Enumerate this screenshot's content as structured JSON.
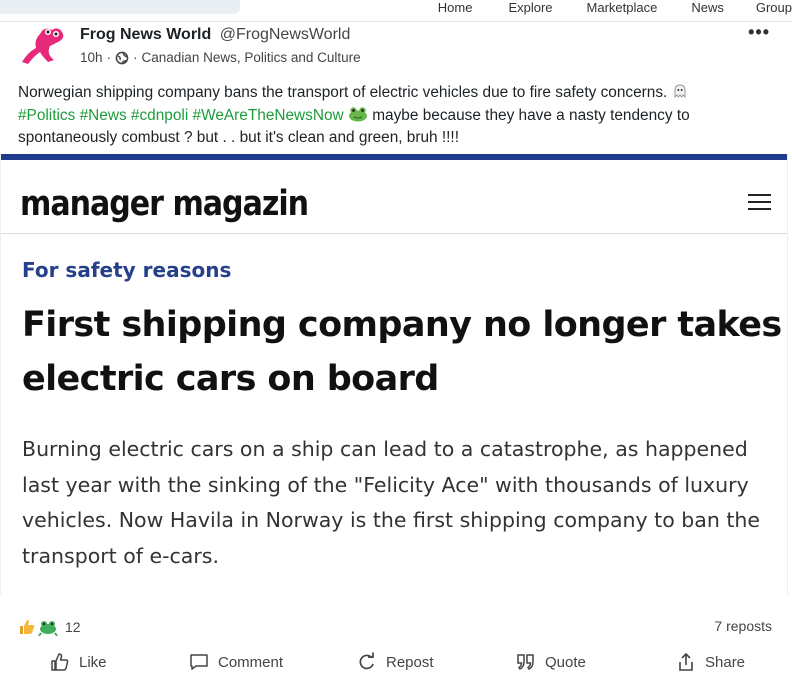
{
  "search": {
    "placeholder": ""
  },
  "nav": {
    "home": "Home",
    "explore": "Explore",
    "marketplace": "Marketplace",
    "news": "News",
    "groups": "Group"
  },
  "post": {
    "author_name": "Frog News World",
    "author_handle": "@FrogNewsWorld",
    "time": "10h",
    "community": "Canadian News, Politics and Culture",
    "text_intro": "Norwegian shipping company bans the transport of electric vehicles due to fire safety concerns.",
    "tags": [
      "#Politics",
      "#News",
      "#cdnpoli",
      "#WeAreTheNewsNow"
    ],
    "text_outro": "maybe because they have a nasty tendency to spontaneously combust ? but . . but it's clean and green, bruh !!!!"
  },
  "article": {
    "source": "manager magazin",
    "kicker": "For safety reasons",
    "headline": "First shipping company no longer takes electric cars on board",
    "lead": "Burning electric cars on a ship can lead to a catastrophe, as happened last year with the sinking of the \"Felicity Ace\" with thousands of luxury vehicles. Now Havila in Norway is the first shipping company to ban the transport of e-cars."
  },
  "stats": {
    "reactions": "12",
    "reposts": "7 reposts"
  },
  "actions": {
    "like": "Like",
    "comment": "Comment",
    "repost": "Repost",
    "quote": "Quote",
    "share": "Share"
  },
  "icons": [
    "frog-avatar-icon",
    "globe-icon",
    "more-icon",
    "ghost-emoji-icon",
    "frog-emoji-icon",
    "hamburger-menu-icon",
    "thumbs-up-icon",
    "comment-icon",
    "repost-icon",
    "quote-icon",
    "share-icon"
  ],
  "colors": {
    "hashtag": "#1e9b3a",
    "card_accent": "#1f3b8e",
    "kicker": "#27408b",
    "avatar": "#e8287a"
  }
}
